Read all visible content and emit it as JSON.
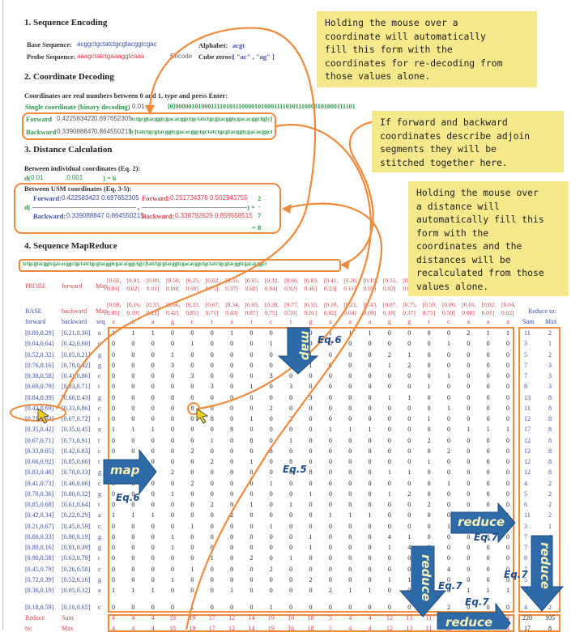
{
  "section1": {
    "title": "1. Sequence Encoding",
    "base_label": "Base Sequence:",
    "base_value": "acggctgctatctgcgtacggtcgac",
    "probe_label": "Probe Sequence:",
    "probe_value": "aaagctatctgaaaggtcaaa",
    "encode_label": "Encode",
    "alphabet_label": "Alphabet:",
    "alphabet_value": "acgt",
    "cube_label": "Cube zeros:",
    "cube_value": "[ \"ac\" , \"ag\" ]"
  },
  "section2": {
    "title": "2. Coordinate Decoding",
    "instructions": "Coordinates are real numbers between 0 and 1, type and press Enter:",
    "single_label": "Single coordinate (binary decoding)",
    "single_value": "0.01",
    "single_result": "[0]000001010001111010111000010100011110101110000101000111101",
    "forward_label": "Forward",
    "forward_x": "0.422583422",
    "forward_y": "0.697652305",
    "forward_result": "tctgcgtacggtcgacacggctgctatctgcgtacggtcgacacggctg[c]",
    "backward_label": "Backward",
    "backward_x": "0.339088847",
    "backward_y": "0.864550215",
    "backward_result": "[c]tatctgcgtacggtcgacacggctgctatctgcgtacggtcgacacggct"
  },
  "section3": {
    "title": "3. Distance Calculation",
    "individual_label": "Between individual coordinates (Eq. 2):",
    "d_open": "d(",
    "ind_a": "0.01",
    "ind_b": ",0.001",
    "ind_result": ") = 6",
    "usm_label": "Between USM coordinates (Eq. 3-5):",
    "left_forward_label": "Forward:",
    "left_forward_value": "0.422583423 0.697652305",
    "left_backward_label": "Backward:",
    "left_backward_value": "0.339088847 0.864550215",
    "right_forward_label": "Forward:",
    "right_forward_value": "0.251734376 0.502943755",
    "right_backward_label": "Backward:",
    "right_backward_value": "0.336792629 0.859558515",
    "comma": ",",
    "close": ") =",
    "frac_num": "2",
    "frac_bar": "-",
    "frac_den": "7",
    "total": "= 8"
  },
  "section4": {
    "title": "4. Sequence MapReduce",
    "stitched": "tctgcgtacggtcgacacggctgctatctgcgtacggtcgacacggctg[c]tatctgcgtacggtcgacacggctgctatctgcgtacggtcgacacggct",
    "probe_label": "PROBE",
    "probe_dir": "forward",
    "base_label": "BASE",
    "base_dir": "backward",
    "map_label": "Map",
    "probe_map": [
      [
        "[0.02,",
        "0.04]"
      ],
      [
        "[0.01,",
        "0.02]"
      ],
      [
        "[0.00,",
        "0.01]"
      ],
      [
        "[0.50,",
        "0.00]"
      ],
      [
        "[0.25,",
        "0.50]"
      ],
      [
        "[0.62,",
        "0.75]"
      ],
      [
        "[0.31,",
        "0.37]"
      ],
      [
        "[0.65,",
        "0.68]"
      ],
      [
        "[0.32,",
        "0.84]"
      ],
      [
        "[0.66,",
        "0.92]"
      ],
      [
        "[0.83,",
        "0.46]"
      ],
      [
        "[0.41,",
        "0.23]"
      ],
      [
        "[0.20,",
        "0.11]"
      ],
      [
        "[0.10,",
        "0.05]"
      ],
      [
        "[0.55,",
        "0.02]"
      ],
      [
        "[0.77,",
        "0.01]"
      ],
      [
        "[0.88,",
        "0.50]"
      ],
      [
        "[0.44,",
        "0.75]"
      ],
      [
        "[0.22,",
        "0.37]"
      ],
      [
        "[0.11,",
        "0.18]"
      ],
      [
        "[0.05,",
        "0.09]"
      ]
    ],
    "base_map": [
      [
        "[0.08,",
        "0.05]"
      ],
      [
        "[0.16,",
        "0.10]"
      ],
      [
        "[0.33,",
        "0.21]"
      ],
      [
        "[0.66,",
        "0.42]"
      ],
      [
        "[0.33,",
        "0.85]"
      ],
      [
        "[0.67,",
        "0.71]"
      ],
      [
        "[0.34,",
        "0.43]"
      ],
      [
        "[0.69,",
        "0.87]"
      ],
      [
        "[0.38,",
        "0.75]"
      ],
      [
        "[0.77,",
        "0.50]"
      ],
      [
        "[0.55,",
        "0.01]"
      ],
      [
        "[0.10,",
        "0.02]"
      ],
      [
        "[0.21,",
        "0.04]"
      ],
      [
        "[0.43,",
        "0.09]"
      ],
      [
        "[0.87,",
        "0.18]"
      ],
      [
        "[0.75,",
        "0.37]"
      ],
      [
        "[0.50,",
        "0.75]"
      ],
      [
        "[0.00,",
        "0.50]"
      ],
      [
        "[0.01,",
        "0.00]"
      ],
      [
        "[0.02,",
        "0.01]"
      ],
      [
        "[0.04,",
        "0.02]"
      ]
    ],
    "reduce_to_label": "Reduce to:",
    "col_forward": "forward",
    "col_backward": "backward",
    "col_seq": "seq",
    "col_sum": "Sum",
    "col_max": "Max",
    "probe_seq": [
      "a",
      "a",
      "a",
      "g",
      "c",
      "t",
      "a",
      "t",
      "c",
      "t",
      "g",
      "a",
      "a",
      "a",
      "g",
      "g",
      "t",
      "c",
      "a",
      "a",
      "a"
    ],
    "rows": [
      {
        "f": "[0.09,0.29]",
        "b": "[0.21,0.30]",
        "s": "a",
        "v": [
          1,
          1,
          1,
          0,
          0,
          0,
          1,
          0,
          0,
          0,
          0,
          1,
          1,
          1,
          0,
          0,
          0,
          0,
          2,
          1,
          1
        ],
        "sum": 11,
        "max": 2
      },
      {
        "f": "[0.04,0.64]",
        "b": "[0.42,0.60]",
        "s": "c",
        "v": [
          0,
          0,
          0,
          0,
          1,
          0,
          0,
          0,
          1,
          0,
          0,
          0,
          0,
          0,
          0,
          0,
          0,
          1,
          0,
          0,
          0
        ],
        "sum": 3,
        "max": 1
      },
      {
        "f": "[0.52,0.32]",
        "b": "[0.85,0.21]",
        "s": "g",
        "v": [
          0,
          0,
          0,
          1,
          0,
          0,
          0,
          0,
          0,
          0,
          1,
          0,
          0,
          0,
          2,
          1,
          0,
          0,
          0,
          0,
          0
        ],
        "sum": 5,
        "max": 2
      },
      {
        "f": "[0.76,0.16]",
        "b": "[0.70,0.42]",
        "s": "g",
        "v": [
          0,
          0,
          0,
          3,
          0,
          0,
          0,
          0,
          0,
          0,
          1,
          0,
          0,
          0,
          1,
          2,
          0,
          0,
          0,
          0,
          0
        ],
        "sum": 7,
        "max": 3
      },
      {
        "f": "[0.38,0.58]",
        "b": "[0.41,0.86]",
        "s": "c",
        "v": [
          0,
          0,
          0,
          0,
          3,
          0,
          0,
          0,
          3,
          0,
          0,
          0,
          0,
          0,
          0,
          0,
          0,
          1,
          0,
          0,
          0
        ],
        "sum": 7,
        "max": 3
      },
      {
        "f": "[0.69,0.79]",
        "b": "[0.83,0.71]",
        "s": "t",
        "v": [
          0,
          0,
          0,
          0,
          0,
          3,
          0,
          1,
          0,
          3,
          0,
          0,
          0,
          0,
          0,
          0,
          1,
          0,
          0,
          0,
          0
        ],
        "sum": 8,
        "max": 3
      },
      {
        "f": "[0.84,0.39]",
        "b": "[0.66,0.43]",
        "s": "g",
        "v": [
          0,
          0,
          0,
          8,
          0,
          0,
          0,
          0,
          0,
          0,
          3,
          0,
          0,
          0,
          1,
          1,
          0,
          0,
          0,
          0,
          0
        ],
        "sum": 13,
        "max": 8
      },
      {
        "f": "[0.42,0.69]",
        "b": "[0.33,0.86]",
        "s": "c",
        "v": [
          0,
          0,
          0,
          0,
          8,
          0,
          0,
          0,
          2,
          0,
          0,
          0,
          0,
          0,
          0,
          0,
          0,
          1,
          0,
          0,
          0
        ],
        "sum": 11,
        "max": 8
      },
      {
        "f": "[0.71,0.84]",
        "b": "[0.67,0.72]",
        "s": "t",
        "v": [
          0,
          0,
          0,
          0,
          0,
          8,
          0,
          1,
          0,
          2,
          0,
          0,
          0,
          0,
          0,
          0,
          1,
          0,
          0,
          0,
          0
        ],
        "sum": 12,
        "max": 8
      },
      {
        "f": "[0.35,0.42]",
        "b": "[0.35,0.45]",
        "s": "a",
        "v": [
          1,
          1,
          1,
          0,
          0,
          0,
          8,
          0,
          0,
          0,
          0,
          1,
          1,
          1,
          0,
          0,
          0,
          0,
          1,
          1,
          1
        ],
        "sum": 17,
        "max": 8
      },
      {
        "f": "[0.67,0.71]",
        "b": "[0.71,0.91]",
        "s": "t",
        "v": [
          0,
          0,
          0,
          0,
          0,
          1,
          0,
          8,
          0,
          1,
          0,
          0,
          0,
          0,
          0,
          0,
          2,
          0,
          0,
          0,
          0
        ],
        "sum": 12,
        "max": 8
      },
      {
        "f": "[0.33,0.85]",
        "b": "[0.42,0.83]",
        "s": "c",
        "v": [
          0,
          0,
          0,
          0,
          2,
          0,
          0,
          0,
          8,
          0,
          0,
          0,
          0,
          0,
          0,
          0,
          0,
          2,
          0,
          0,
          0
        ],
        "sum": 12,
        "max": 8
      },
      {
        "f": "[0.66,0.92]",
        "b": "[0.85,0.66]",
        "s": "t",
        "v": [
          0,
          0,
          0,
          0,
          0,
          2,
          0,
          1,
          0,
          8,
          0,
          0,
          0,
          0,
          0,
          0,
          1,
          0,
          0,
          0,
          0
        ],
        "sum": 12,
        "max": 8
      },
      {
        "f": "[0.83,0.46]",
        "b": "[0.70,0.33]",
        "s": "g",
        "v": [
          0,
          0,
          0,
          2,
          0,
          0,
          0,
          0,
          0,
          0,
          8,
          0,
          0,
          0,
          1,
          1,
          0,
          0,
          0,
          0,
          0
        ],
        "sum": 12,
        "max": 8
      },
      {
        "f": "[0.41,0.73]",
        "b": "[0.40,0.66]",
        "s": "c",
        "v": [
          0,
          0,
          0,
          0,
          2,
          0,
          0,
          0,
          1,
          0,
          0,
          0,
          0,
          0,
          0,
          0,
          0,
          1,
          0,
          0,
          0
        ],
        "sum": 4,
        "max": 2
      },
      {
        "f": "[0.70,0.36]",
        "b": "[0.80,0.32]",
        "s": "g",
        "v": [
          0,
          0,
          0,
          1,
          0,
          0,
          0,
          0,
          0,
          0,
          1,
          0,
          0,
          0,
          1,
          2,
          0,
          0,
          0,
          0,
          0
        ],
        "sum": 5,
        "max": 2
      },
      {
        "f": "[0.85,0.68]",
        "b": "[0.61,0.64]",
        "s": "t",
        "v": [
          0,
          0,
          0,
          0,
          0,
          2,
          0,
          1,
          0,
          1,
          0,
          0,
          0,
          0,
          0,
          0,
          2,
          0,
          0,
          0,
          0
        ],
        "sum": 6,
        "max": 2
      },
      {
        "f": "[0.42,0.34]",
        "b": "[0.22,0.29]",
        "s": "a",
        "v": [
          1,
          1,
          1,
          0,
          0,
          0,
          2,
          0,
          0,
          0,
          0,
          1,
          1,
          1,
          0,
          0,
          0,
          0,
          1,
          1,
          1
        ],
        "sum": 11,
        "max": 2
      },
      {
        "f": "[0.21,0.67]",
        "b": "[0.45,0.59]",
        "s": "c",
        "v": [
          0,
          0,
          0,
          0,
          1,
          0,
          0,
          0,
          1,
          0,
          0,
          0,
          0,
          0,
          0,
          0,
          0,
          1,
          0,
          0,
          0
        ],
        "sum": 3,
        "max": 1
      },
      {
        "f": "[0.60,0.33]",
        "b": "[0.90,0.19]",
        "s": "g",
        "v": [
          0,
          0,
          0,
          1,
          0,
          0,
          0,
          0,
          0,
          0,
          1,
          0,
          0,
          0,
          4,
          1,
          0,
          0,
          0,
          0,
          0
        ],
        "sum": 7,
        "max": 4
      },
      {
        "f": "[0.80,0.16]",
        "b": "[0.81,0.39]",
        "s": "g",
        "v": [
          0,
          0,
          0,
          1,
          0,
          0,
          0,
          0,
          0,
          0,
          1,
          0,
          0,
          0,
          1,
          4,
          0,
          0,
          0,
          0,
          0
        ],
        "sum": 7,
        "max": 4
      },
      {
        "f": "[0.90,0.58]",
        "b": "[0.63,0.79]",
        "s": "t",
        "v": [
          0,
          0,
          0,
          0,
          0,
          1,
          0,
          2,
          0,
          1,
          0,
          0,
          0,
          0,
          0,
          0,
          4,
          0,
          0,
          0,
          0
        ],
        "sum": 8,
        "max": 4
      },
      {
        "f": "[0.45,0.79]",
        "b": "[0.26,0.58]",
        "s": "c",
        "v": [
          0,
          0,
          0,
          0,
          1,
          0,
          0,
          0,
          2,
          0,
          0,
          0,
          0,
          0,
          0,
          0,
          0,
          4,
          0,
          0,
          0
        ],
        "sum": 7,
        "max": 4
      },
      {
        "f": "[0.72,0.39]",
        "b": "[0.52,0.16]",
        "s": "g",
        "v": [
          0,
          0,
          0,
          1,
          0,
          0,
          0,
          0,
          0,
          0,
          2,
          0,
          0,
          0,
          1,
          1,
          0,
          0,
          0,
          0,
          0
        ],
        "sum": 5,
        "max": 2
      },
      {
        "f": "[0.36,0.19]",
        "b": "[0.05,0.32]",
        "s": "a",
        "v": [
          1,
          1,
          1,
          0,
          0,
          0,
          1,
          0,
          0,
          0,
          0,
          2,
          1,
          1,
          0,
          0,
          0,
          0,
          1,
          1,
          1
        ],
        "sum": 12,
        "max": 2
      },
      {
        "f": "[0.18,0.59]",
        "b": "[0.10,0.65]",
        "s": "c",
        "v": [
          0,
          0,
          0,
          0,
          1,
          0,
          0,
          0,
          1,
          0,
          0,
          0,
          0,
          0,
          0,
          0,
          0,
          2,
          0,
          0,
          0
        ],
        "sum": 4,
        "max": 2
      }
    ],
    "reduce_label": "Reduce",
    "to_label": "to:",
    "sum_label": "Sum",
    "max_label": "Max",
    "reduce_sum": [
      4,
      4,
      4,
      18,
      19,
      17,
      12,
      14,
      19,
      16,
      18,
      5,
      4,
      4,
      12,
      13,
      11,
      13,
      5,
      4,
      4
    ],
    "reduce_max": [
      4,
      4,
      4,
      18,
      19,
      17,
      12,
      14,
      19,
      16,
      18,
      5,
      4,
      4,
      12,
      13,
      11,
      13,
      5,
      4,
      4
    ],
    "total_sum": "220",
    "total_sum_max": "105",
    "total_max_sum": "17",
    "total_max_max": "8"
  },
  "annotations": {
    "note_coordinate": "Holding the mouse over a\ncoordinate will automatically\nfill this form with the\ncoordinates for re-decoding from\nthose values alone.",
    "note_stitch": "If forward and backward\ncoordinates describe adjoin\nsegments they will be\nstitched together here.",
    "note_distance": "Holding the mouse over\na distance will\nautomatically fill this\nform with the\ncoordinates and the\ndistances will be\nrecalculated from those\nvalues alone.",
    "map": "map",
    "reduce": "reduce",
    "eq5": "Eq.5",
    "eq6": "Eq.6",
    "eq7": "Eq.7"
  },
  "colors": {
    "accent_orange": "#f08a3c",
    "note_yellow": "#f6e98c",
    "arrow_blue": "#2f6aa8",
    "text_blue": "#3a4fb0",
    "text_green": "#2e9a4a",
    "text_red": "#e8404a"
  }
}
